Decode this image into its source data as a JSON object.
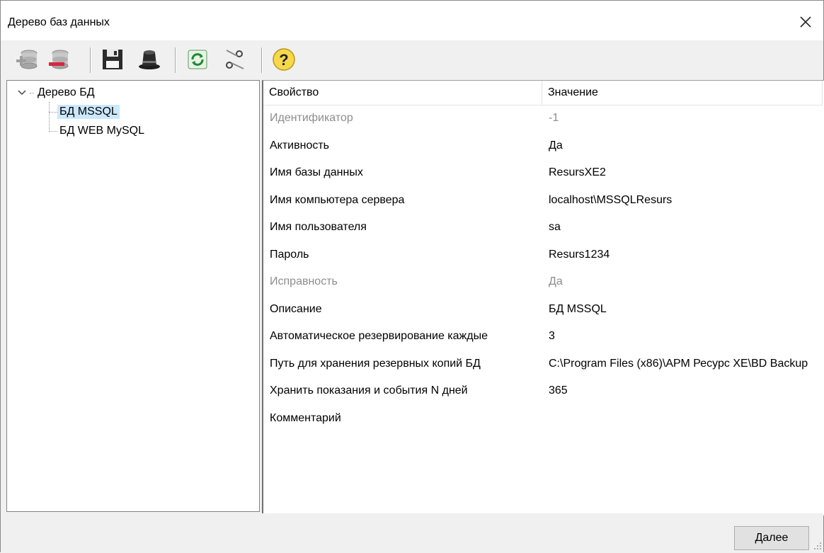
{
  "window": {
    "title": "Дерево баз данных",
    "close_icon": "close-icon"
  },
  "toolbar": {
    "buttons": [
      {
        "name": "add-database-icon",
        "interactable": true
      },
      {
        "name": "remove-database-icon",
        "interactable": true
      },
      {
        "name": "save-icon",
        "interactable": true
      },
      {
        "name": "magic-hat-icon",
        "interactable": true
      },
      {
        "name": "refresh-icon",
        "interactable": true
      },
      {
        "name": "scissors-icon",
        "interactable": true
      },
      {
        "name": "help-icon",
        "interactable": true
      }
    ]
  },
  "tree": {
    "root_label": "Дерево БД",
    "items": [
      {
        "label": "БД MSSQL",
        "selected": true
      },
      {
        "label": "БД WEB MySQL",
        "selected": false
      }
    ]
  },
  "grid": {
    "col_property": "Свойство",
    "col_value": "Значение",
    "rows": [
      {
        "property": "Идентификатор",
        "value": "-1",
        "disabled": true
      },
      {
        "property": "Активность",
        "value": "Да",
        "disabled": false
      },
      {
        "property": "Имя базы данных",
        "value": "ResursXE2",
        "disabled": false
      },
      {
        "property": "Имя компьютера сервера",
        "value": "localhost\\MSSQLResurs",
        "disabled": false
      },
      {
        "property": "Имя пользователя",
        "value": "sa",
        "disabled": false
      },
      {
        "property": "Пароль",
        "value": "Resurs1234",
        "disabled": false
      },
      {
        "property": "Исправность",
        "value": "Да",
        "disabled": true
      },
      {
        "property": "Описание",
        "value": "БД MSSQL",
        "disabled": false
      },
      {
        "property": "Автоматическое резервирование каждые",
        "value": "3",
        "disabled": false
      },
      {
        "property": "Путь для хранения резервных копий БД",
        "value": "C:\\Program Files (x86)\\АРМ Ресурс XE\\BD Backup",
        "disabled": false
      },
      {
        "property": "Хранить показания и события N дней",
        "value": "365",
        "disabled": false
      },
      {
        "property": "Комментарий",
        "value": "",
        "disabled": false
      }
    ]
  },
  "footer": {
    "next_label": "Далее"
  },
  "colors": {
    "selection": "#cce8ff",
    "disabled_text": "#8d8d8d",
    "window_bg": "#f0f0f0"
  }
}
